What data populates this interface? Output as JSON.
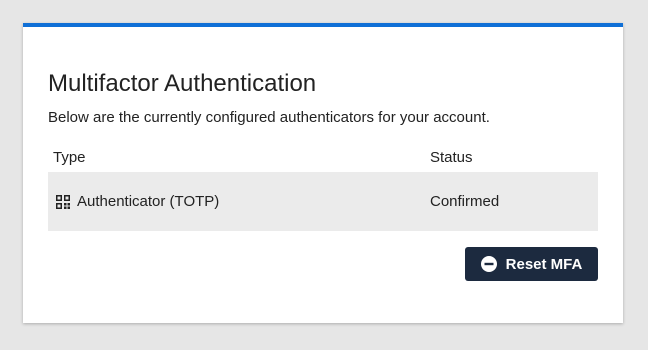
{
  "card": {
    "title": "Multifactor Authentication",
    "description": "Below are the currently configured authenticators for your account.",
    "accent_color": "#0f6fd6"
  },
  "table": {
    "headers": {
      "type": "Type",
      "status": "Status"
    },
    "rows": [
      {
        "icon": "qr-code-icon",
        "type": "Authenticator (TOTP)",
        "status": "Confirmed"
      }
    ]
  },
  "actions": {
    "reset_label": "Reset MFA",
    "reset_icon": "minus-circle-icon",
    "button_color": "#1c2a3f"
  }
}
